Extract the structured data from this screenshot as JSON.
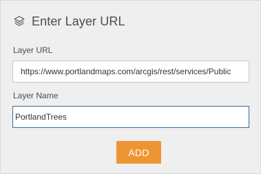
{
  "dialog": {
    "title": "Enter Layer URL",
    "icon": "layers-icon"
  },
  "form": {
    "url_label": "Layer URL",
    "url_value": "https://www.portlandmaps.com/arcgis/rest/services/Public",
    "name_label": "Layer Name",
    "name_value": "PortlandTrees"
  },
  "actions": {
    "add_label": "ADD"
  },
  "colors": {
    "accent": "#ee9533",
    "focus_border": "#3a6a96",
    "panel_background": "#efefef"
  }
}
